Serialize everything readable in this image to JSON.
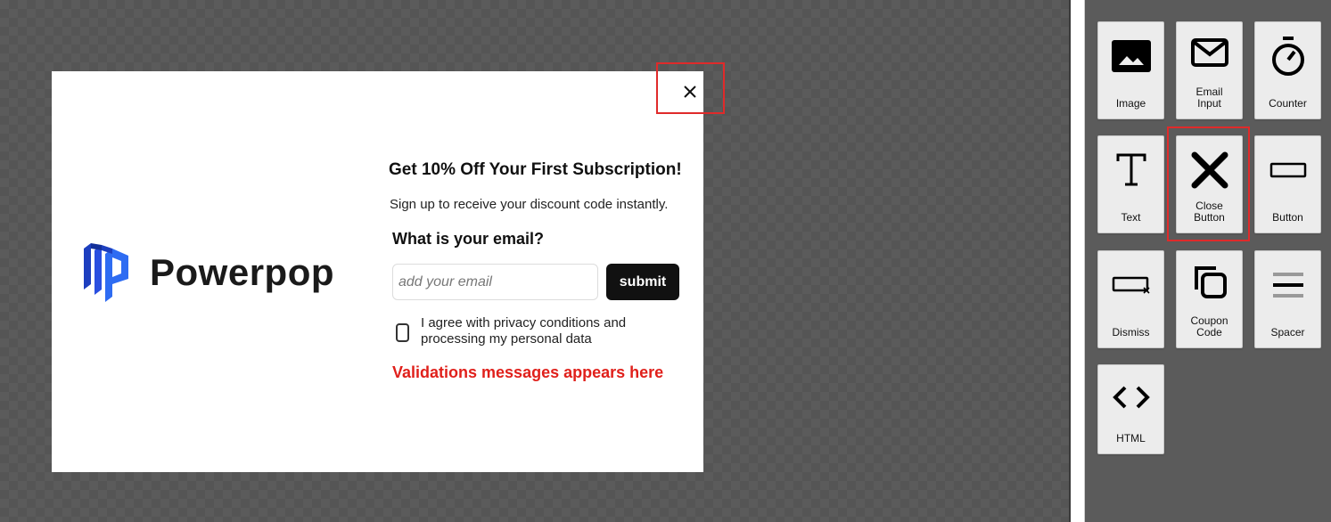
{
  "popup": {
    "logo_text": "Powerpop",
    "headline": "Get 10% Off Your First Subscription!",
    "subline": "Sign up to receive your discount code instantly.",
    "question": "What is your email?",
    "email_placeholder": "add your email",
    "submit_label": "submit",
    "agree_text": "I agree with privacy conditions and processing my personal data",
    "validation_text": "Validations messages appears here",
    "validation_color": "#e0201b"
  },
  "palette": {
    "tiles": [
      {
        "label": "Image",
        "icon": "image-icon"
      },
      {
        "label": "Email\nInput",
        "icon": "email-icon"
      },
      {
        "label": "Counter",
        "icon": "timer-icon"
      },
      {
        "label": "Text",
        "icon": "text-icon"
      },
      {
        "label": "Close\nButton",
        "icon": "close-icon"
      },
      {
        "label": "Button",
        "icon": "button-icon"
      },
      {
        "label": "Dismiss",
        "icon": "dismiss-icon"
      },
      {
        "label": "Coupon\nCode",
        "icon": "copy-icon"
      },
      {
        "label": "Spacer",
        "icon": "spacer-icon"
      },
      {
        "label": "HTML",
        "icon": "code-icon"
      }
    ]
  },
  "highlight_color": "#e02a2a"
}
